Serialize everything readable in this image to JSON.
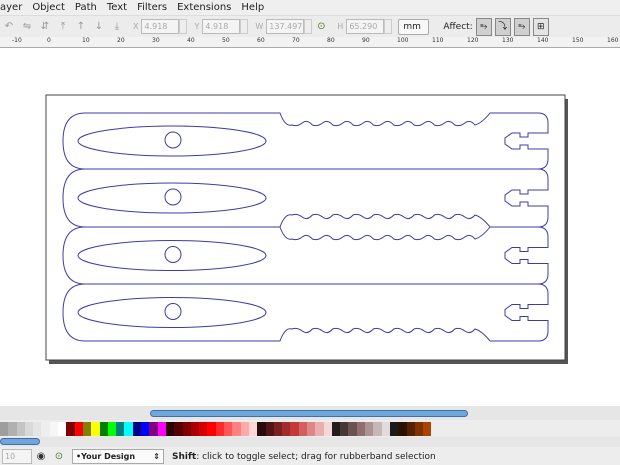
{
  "menu": [
    "ayer",
    "Object",
    "Path",
    "Text",
    "Filters",
    "Extensions",
    "Help"
  ],
  "toolbar": {
    "x_label": "X",
    "x_value": "4.918",
    "y_label": "Y",
    "y_value": "4.918",
    "w_label": "W",
    "w_value": "137.497",
    "h_label": "H",
    "h_value": "65.290",
    "unit": "mm",
    "affect_label": "Affect:"
  },
  "ruler": [
    "-10",
    "0",
    "10",
    "20",
    "30",
    "40",
    "50",
    "60",
    "70",
    "80",
    "90",
    "100",
    "110",
    "120",
    "130",
    "140",
    "150",
    "160"
  ],
  "palette": [
    "#9e9e9e",
    "#b0b0b0",
    "#c4c4c4",
    "#d8d8d8",
    "#e4e4e4",
    "#eeeeee",
    "#f6f6f6",
    "#ffffff",
    "#800000",
    "#ff0000",
    "#808000",
    "#ffff00",
    "#008000",
    "#00ff00",
    "#008080",
    "#00ffff",
    "#000080",
    "#0000ff",
    "#800080",
    "#ff00ff",
    "#2b0000",
    "#550000",
    "#800000",
    "#aa0000",
    "#d40000",
    "#ff0000",
    "#ff2a2a",
    "#ff5555",
    "#ff8080",
    "#ffaaaa",
    "#ffd5d5",
    "#280b0b",
    "#501616",
    "#782121",
    "#a02c2c",
    "#c83737",
    "#d35f5f",
    "#de8787",
    "#e9afaf",
    "#f4d7d7",
    "#241c1c",
    "#483737",
    "#6c5353",
    "#916f6f",
    "#ac9393",
    "#c8b7b7",
    "#e3dbdb",
    "#1a1a1a",
    "#2b1100",
    "#552200",
    "#803300",
    "#aa4400"
  ],
  "status": {
    "zoom": "10",
    "layer": "•Your Design",
    "msg_key": "Shift",
    "msg": ": click to toggle select; drag for rubberband selection"
  },
  "colors": {
    "outline": "#3c3ca8",
    "accent": "#6fa7dd"
  }
}
